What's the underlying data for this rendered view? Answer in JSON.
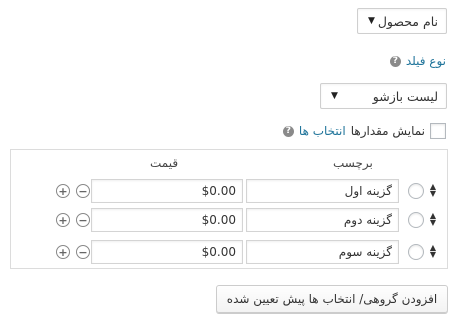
{
  "field_select": {
    "value": "نام محصول"
  },
  "field_type": {
    "link": "نوع فیلد"
  },
  "type_select": {
    "value": "لیست بازشو"
  },
  "show_values": {
    "label": "نمایش مقدارها",
    "link": "انتخاب ها",
    "checked": false
  },
  "table": {
    "label_header": "برچسب",
    "price_header": "قیمت",
    "rows": [
      {
        "label": "گزینه اول",
        "price": "$0.00"
      },
      {
        "label": "گزینه دوم",
        "price": "$0.00"
      },
      {
        "label": "گزینه سوم",
        "price": "$0.00"
      }
    ]
  },
  "bulk_button": {
    "label": "افزودن گروهی/ انتخاب ها پیش تعیین شده"
  },
  "icons": {
    "help": "help-icon",
    "sort": "sort-arrows-icon",
    "add": "plus-icon",
    "remove": "minus-icon"
  }
}
